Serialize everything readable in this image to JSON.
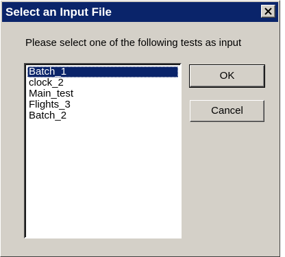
{
  "window": {
    "title": "Select an Input File",
    "close_icon": "close-icon"
  },
  "prompt": "Please select one of the following tests as input",
  "list": {
    "items": [
      {
        "label": "Batch_1",
        "selected": true
      },
      {
        "label": "clock_2",
        "selected": false
      },
      {
        "label": "Main_test",
        "selected": false
      },
      {
        "label": "Flights_3",
        "selected": false
      },
      {
        "label": "Batch_2",
        "selected": false
      }
    ]
  },
  "buttons": {
    "ok_label": "OK",
    "cancel_label": "Cancel"
  },
  "colors": {
    "title_bar": "#0a246a",
    "dialog_face": "#d4d0c8",
    "selection": "#0a246a"
  }
}
